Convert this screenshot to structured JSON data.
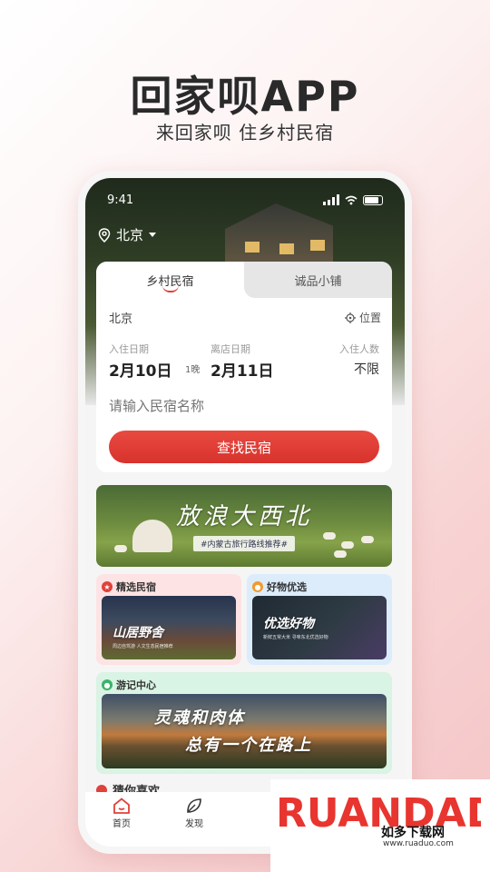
{
  "promo": {
    "headline": "回家呗APP",
    "subline": "来回家呗 住乡村民宿"
  },
  "status_bar": {
    "time": "9:41"
  },
  "location": {
    "city": "北京"
  },
  "search_card": {
    "tabs": [
      {
        "label": "乡村民宿",
        "active": true
      },
      {
        "label": "诚品小铺",
        "active": false
      }
    ],
    "city": "北京",
    "position_label": "位置",
    "checkin_label": "入住日期",
    "checkin_date": "2月10日",
    "nights": "1晚",
    "checkout_label": "离店日期",
    "checkout_date": "2月11日",
    "guests_label": "入住人数",
    "guests_value": "不限",
    "search_placeholder": "请输入民宿名称",
    "find_button": "查找民宿"
  },
  "banner": {
    "title": "放浪大西北",
    "subtitle": "#内蒙古旅行路线推荐#"
  },
  "sections": {
    "featured_homestay": {
      "title": "精选民宿",
      "image_text": "山居野舍",
      "image_small": "周边自驾游 人文生态民宿推荐"
    },
    "good_picks": {
      "title": "好物优选",
      "image_text": "优选好物",
      "image_small": "新鲜五常大米 寻味东北优选好物"
    },
    "travelogue": {
      "title": "游记中心",
      "line1": "灵魂和肉体",
      "line2": "总有一个在路上"
    },
    "guess_you_like": {
      "title": "猜你喜欢"
    }
  },
  "tabbar": {
    "items": [
      {
        "label": "首页",
        "icon": "home-icon",
        "active": true
      },
      {
        "label": "发现",
        "icon": "leaf-icon",
        "active": false
      }
    ]
  },
  "watermark": {
    "logo": "RUANDADO",
    "cn": "如多下载网",
    "url": "www.ruaduo.com"
  },
  "colors": {
    "accent": "#e0413a",
    "featured_bg": "#fde3e3",
    "picks_bg": "#dcecfb",
    "travel_bg": "#d9f3e4"
  }
}
